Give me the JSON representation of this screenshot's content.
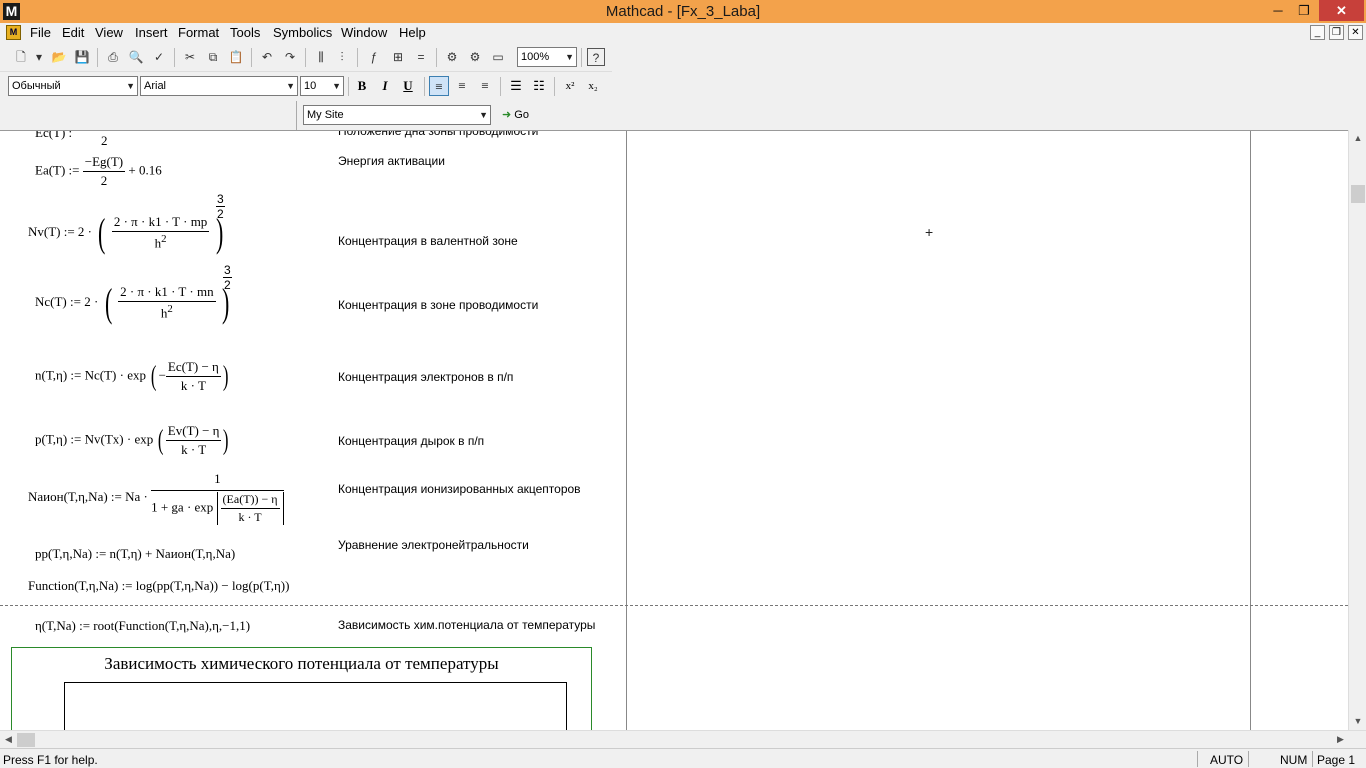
{
  "window": {
    "title": "Mathcad - [Fx_3_Laba]",
    "app_icon": "M"
  },
  "menu": [
    "File",
    "Edit",
    "View",
    "Insert",
    "Format",
    "Tools",
    "Symbolics",
    "Window",
    "Help"
  ],
  "toolbar": {
    "zoom": "100%"
  },
  "format_bar": {
    "style": "Обычный",
    "font": "Arial",
    "size": "10"
  },
  "web_bar": {
    "site": "My Site",
    "go_label": "Go"
  },
  "equations": {
    "ec_top": "Ec(T) :",
    "ec_top_den": "2",
    "ea_lhs": "Ea(T) :=",
    "ea_num": "−Eg(T)",
    "ea_den": "2",
    "ea_tail": "+ 0.16",
    "nv_lhs": "Nv(T) := 2 ·",
    "nv_num": "2 · π · k1 · T · mp",
    "nv_den": "h",
    "nv_exp_n": "3",
    "nv_exp_d": "2",
    "nc_lhs": "Nc(T) := 2 ·",
    "nc_num": "2 · π · k1 · T · mn",
    "nc_den": "h",
    "nc_exp_n": "3",
    "nc_exp_d": "2",
    "n_lhs": "n(T,η) := Nc(T) · exp",
    "n_num": "Ec(T) − η",
    "n_den": "k · T",
    "p_lhs": "p(T,η) := Nv(Tx) · exp",
    "p_num": "Ev(T) − η",
    "p_den": "k · T",
    "na_lhs": "Naион(T,η,Na) := Na ·",
    "na_num": "1",
    "na_den_pre": "1 + ga · exp",
    "na_inner_num": "(Ea(T)) − η",
    "na_inner_den": "k · T",
    "pp": "pp(T,η,Na) := n(T,η) + Naион(T,η,Na)",
    "func": "Function(T,η,Na) := log(pp(T,η,Na)) − log(p(T,η))",
    "eta": "η(T,Na) := root(Function(T,η,Na),η,−1,1)"
  },
  "comments": {
    "c0": "Положение дна зоны проводимости",
    "c1": "Энергия активации",
    "c2": "Концентрация в валентной зоне",
    "c3": "Концентрация в зоне проводимости",
    "c4": "Концентрация электронов в п/п",
    "c5": "Концентрация дырок в п/п",
    "c6": "Концентрация ионизированных акцепторов",
    "c7": "Уравнение электронейтральности",
    "c8": "Зависимость хим.потенциала от температуры"
  },
  "chart": {
    "title": "Зависимость химического потенциала от температуры"
  },
  "status": {
    "help": "Press F1 for help.",
    "mode": "AUTO",
    "num": "NUM",
    "page": "Page 1"
  }
}
